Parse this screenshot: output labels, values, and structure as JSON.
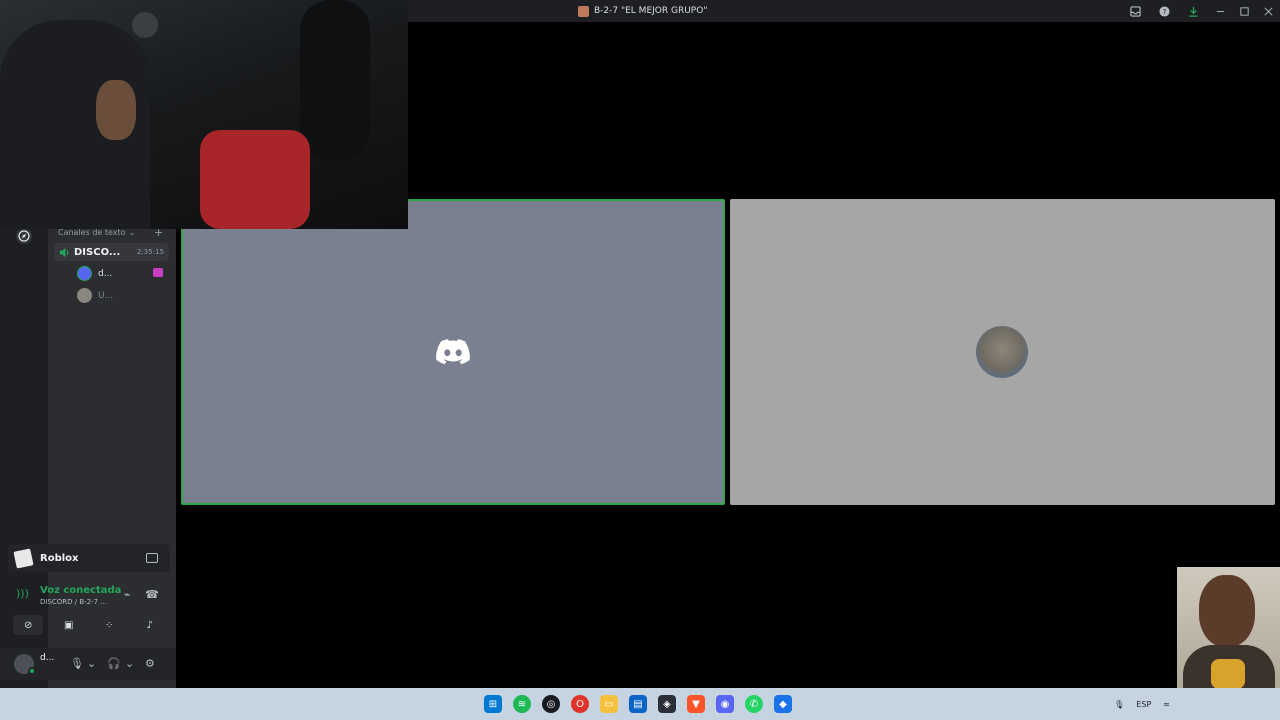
{
  "window": {
    "title": "B-2-7 \"EL MEJOR GRUPO\""
  },
  "channels": {
    "category": "Canales de texto",
    "voice_channel": {
      "name": "DISCO...",
      "timer": "2:35:15"
    },
    "members": [
      {
        "name": "d..."
      },
      {
        "name": "U..."
      }
    ]
  },
  "activity": {
    "label": "Roblox"
  },
  "voice_status": {
    "title": "Voz conectada",
    "subtitle": "DISCORD / B-2-7 ..."
  },
  "user": {
    "name": "d..."
  },
  "taskbar": {
    "lang": "ESP",
    "apps": [
      "windows-start",
      "spotify",
      "steam",
      "opera",
      "file-explorer",
      "outlook",
      "davinci",
      "brave",
      "discord",
      "whatsapp",
      "roblox"
    ]
  },
  "colors": {
    "accent_green": "#23a55a",
    "speaking_border": "#2ba84a",
    "discord_blurple": "#5865f2",
    "tile_a_bg": "#7a8090",
    "tile_b_bg": "#a6a6a4"
  }
}
